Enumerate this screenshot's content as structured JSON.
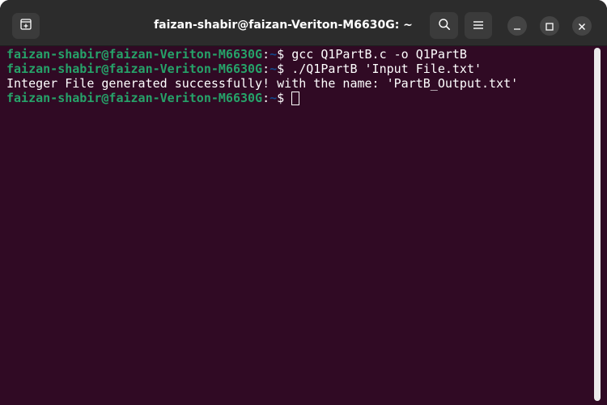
{
  "window": {
    "title": "faizan-shabir@faizan-Veriton-M6630G: ~"
  },
  "titlebar": {
    "new_tab_icon": "new-tab-icon",
    "search_icon": "search-icon",
    "menu_icon": "hamburger-menu-icon",
    "minimize_icon": "minimize-icon",
    "maximize_icon": "maximize-icon",
    "close_icon": "close-icon"
  },
  "terminal": {
    "lines": [
      {
        "user_host": "faizan-shabir@faizan-Veriton-M6630G",
        "sep": ":",
        "path": "~",
        "prompt": "$ ",
        "command": "gcc Q1PartB.c -o Q1PartB"
      },
      {
        "user_host": "faizan-shabir@faizan-Veriton-M6630G",
        "sep": ":",
        "path": "~",
        "prompt": "$ ",
        "command": "./Q1PartB 'Input File.txt'"
      },
      {
        "output": "Integer File generated successfully! with the name: 'PartB_Output.txt'"
      },
      {
        "user_host": "faizan-shabir@faizan-Veriton-M6630G",
        "sep": ":",
        "path": "~",
        "prompt": "$ ",
        "command": ""
      }
    ]
  },
  "colors": {
    "terminal_background": "#300a24",
    "titlebar_background": "#2c2c2c",
    "prompt_user_host": "#26a269",
    "prompt_path": "#12488b",
    "text": "#ffffff"
  }
}
